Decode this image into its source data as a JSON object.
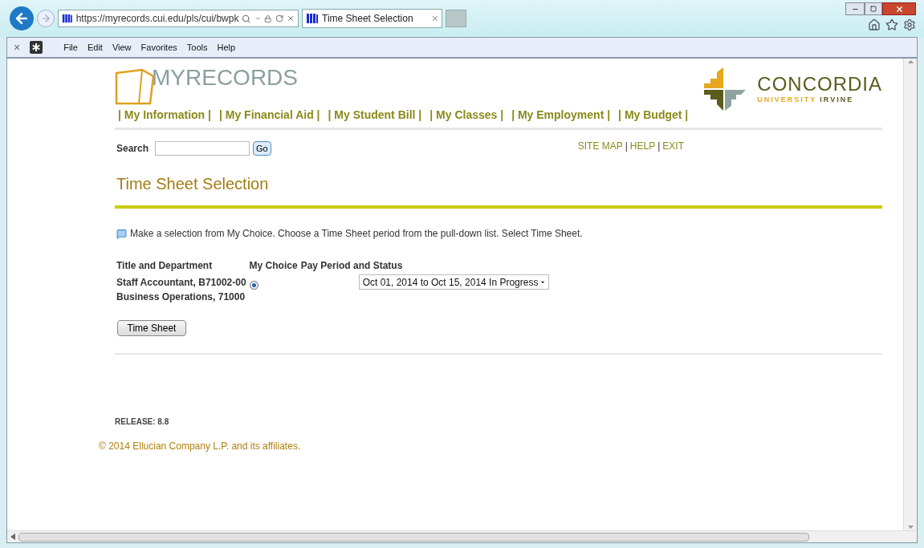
{
  "browser": {
    "address": "https://myrecords.cui.edu/pls/cui/bwpk",
    "tab": {
      "title": "Time Sheet Selection",
      "close": "×"
    },
    "menu": [
      "File",
      "Edit",
      "View",
      "Favorites",
      "Tools",
      "Help"
    ],
    "close_bar": "×"
  },
  "header": {
    "logo": "MYRECORDS",
    "brand": {
      "name": "CONCORDIA",
      "sub1": "UNIVERSITY",
      "sub2": "IRVINE"
    },
    "nav": [
      "| My Information |",
      "| My Financial Aid |",
      "| My Student Bill |",
      "| My Classes |",
      "| My Employment |",
      "| My Budget |"
    ]
  },
  "search": {
    "label": "Search",
    "button": "Go"
  },
  "links": [
    {
      "kind": "link",
      "text": "SITE MAP"
    },
    {
      "kind": "separator",
      "text": "|"
    },
    {
      "kind": "link",
      "text": "HELP"
    },
    {
      "kind": "separator",
      "text": "|"
    },
    {
      "kind": "link",
      "text": "EXIT"
    }
  ],
  "title": "Time Sheet Selection",
  "instructions": "Make a selection from My Choice. Choose a Time Sheet period from the pull-down list. Select Time Sheet.",
  "table": {
    "columns": [
      "Title and Department",
      "My Choice",
      "Pay Period and Status"
    ],
    "rows": [
      {
        "title": "Staff Accountant, B71002-00",
        "department": "Business Operations, 71000",
        "selected": true,
        "period": "Oct 01, 2014 to Oct 15, 2014 In Progress"
      }
    ]
  },
  "submit": "Time Sheet",
  "release": "RELEASE: 8.8",
  "copyright": "© 2014 Ellucian Company L.P. and its affiliates."
}
